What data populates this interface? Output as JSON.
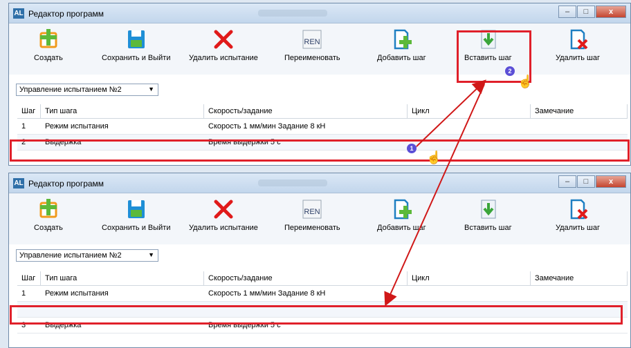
{
  "window": {
    "title": "Редактор программ",
    "app_icon": "AL",
    "caption": {
      "minimize": "‒",
      "maximize": "□",
      "close": "x"
    }
  },
  "toolbar": [
    {
      "label": "Создать",
      "icon": "create-icon"
    },
    {
      "label": "Сохранить и Выйти",
      "icon": "save-icon"
    },
    {
      "label": "Удалить испытание",
      "icon": "delete-test-icon"
    },
    {
      "label": "Переименовать",
      "icon": "rename-icon",
      "icon_text": "REN"
    },
    {
      "label": "Добавить шаг",
      "icon": "add-step-icon"
    },
    {
      "label": "Вставить шаг",
      "icon": "insert-step-icon"
    },
    {
      "label": "Удалить шаг",
      "icon": "delete-step-icon"
    }
  ],
  "program_select": {
    "value": "Управление испытанием №2"
  },
  "columns": [
    "Шаг",
    "Тип шага",
    "Скорость/задание",
    "Цикл",
    "Замечание"
  ],
  "before_rows": [
    [
      "1",
      "Режим испытания",
      "Скорость 1 мм/мин Задание 8 кН",
      "",
      ""
    ],
    [
      "2",
      "Выдержка",
      "Время выдержки 5 с",
      "",
      ""
    ]
  ],
  "after_rows": [
    [
      "1",
      "Режим испытания",
      "Скорость 1 мм/мин Задание 8 кН",
      "",
      ""
    ],
    [
      "",
      "",
      "",
      "",
      ""
    ],
    [
      "3",
      "Выдержка",
      "Время выдержки 5 с",
      "",
      ""
    ]
  ],
  "badges": {
    "step1": "1",
    "step2": "2"
  },
  "colors": {
    "highlight": "#e0202a",
    "badge": "#5b4fd6",
    "arrow": "#d01818"
  }
}
